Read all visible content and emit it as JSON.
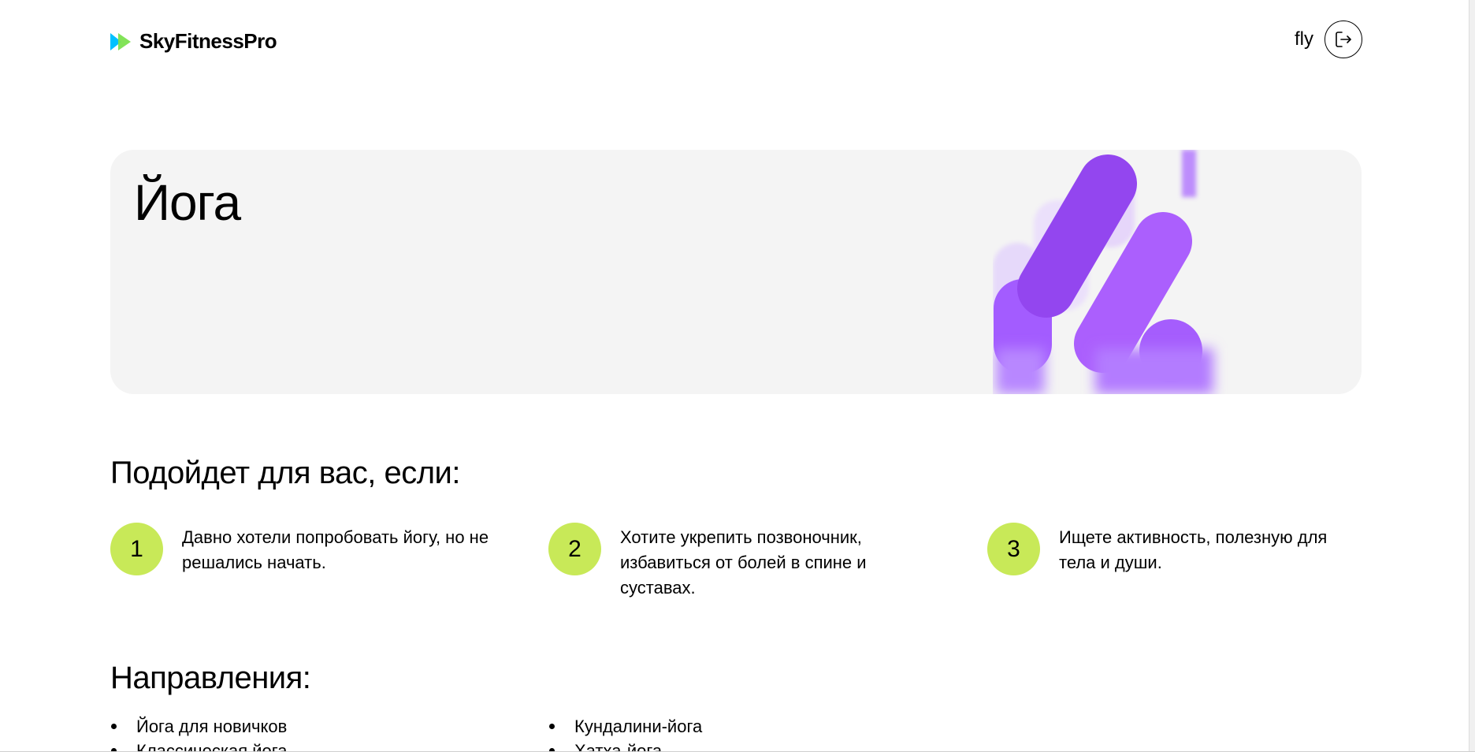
{
  "header": {
    "logo_text": "SkyFitnessPro",
    "user_name": "fly",
    "logout_icon": "logout-icon"
  },
  "hero": {
    "title": "Йога"
  },
  "suitability": {
    "title": "Подойдет для вас, если:",
    "items": [
      {
        "num": "1",
        "text": "Давно хотели попробовать йогу, но не решались начать."
      },
      {
        "num": "2",
        "text": "Хотите укрепить позвоночник, избавиться от болей в спине и суставах."
      },
      {
        "num": "3",
        "text": "Ищете активность, полезную для тела и души."
      }
    ]
  },
  "directions": {
    "title": "Направления:",
    "col1": [
      "Йога для новичков",
      "Классическая йога"
    ],
    "col2": [
      "Кундалини-йога",
      "Хатха-йога"
    ]
  },
  "colors": {
    "accent_green": "#c8e958",
    "accent_purple": "#a259ff",
    "logo_green": "#00c1ff"
  }
}
